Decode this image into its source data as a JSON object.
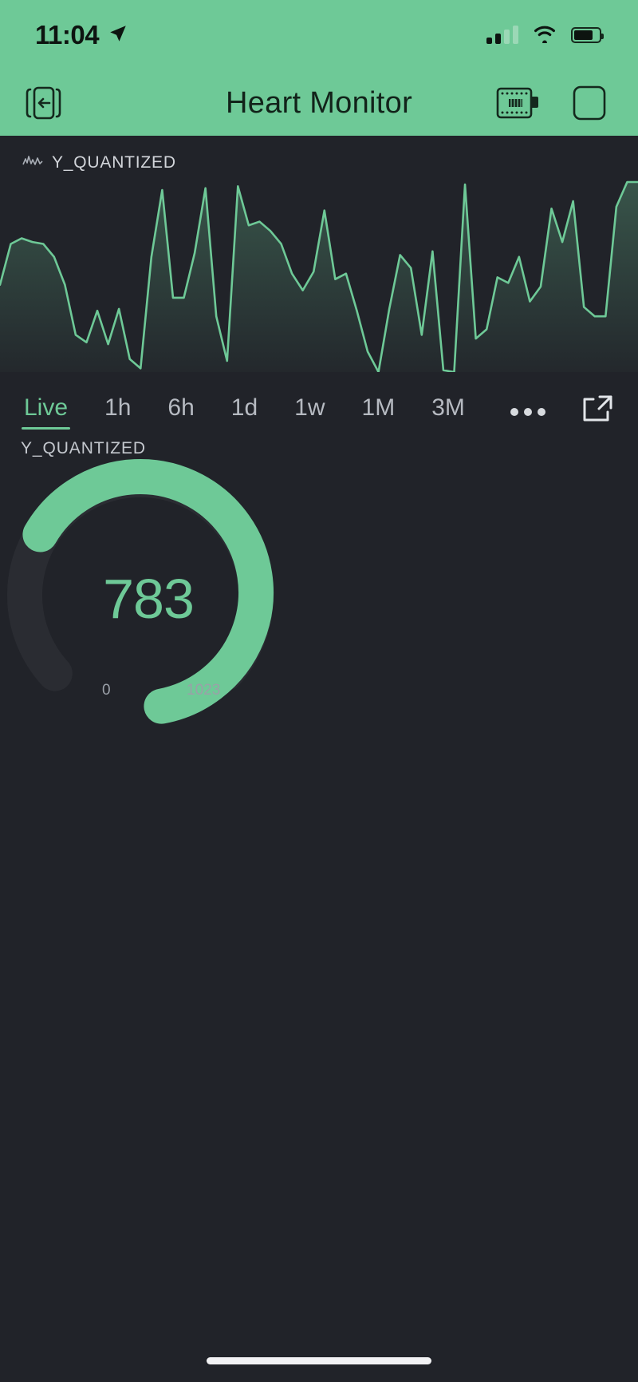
{
  "status_bar": {
    "time": "11:04",
    "location_icon": "location-arrow-icon",
    "signal_icon": "cellular-signal-icon",
    "wifi_icon": "wifi-icon",
    "battery_icon": "battery-icon",
    "signal_bars_filled": 2,
    "signal_bars_total": 4,
    "battery_level_percent": 75
  },
  "nav": {
    "title": "Heart Monitor",
    "back_icon": "device-exit-icon",
    "board_icon": "circuit-board-icon",
    "menu_icon": "rounded-square-icon"
  },
  "sparkline_card": {
    "label": "Y_QUANTIZED",
    "icon": "sparkline-icon"
  },
  "ranges": {
    "items": [
      {
        "label": "Live",
        "active": true
      },
      {
        "label": "1h",
        "active": false
      },
      {
        "label": "6h",
        "active": false
      },
      {
        "label": "1d",
        "active": false
      },
      {
        "label": "1w",
        "active": false
      },
      {
        "label": "1M",
        "active": false
      },
      {
        "label": "3M",
        "active": false
      }
    ],
    "more_icon": "more-options-icon",
    "share_icon": "external-link-icon"
  },
  "gauge": {
    "label": "Y_QUANTIZED",
    "value": "783",
    "min": "0",
    "max": "1023"
  },
  "colors": {
    "accent": "#6ec997",
    "header_bg": "#6ec997",
    "page_bg": "#212329",
    "gauge_track": "#2a2c32",
    "text_primary": "#d2d5da",
    "text_muted": "#9ba0a8"
  },
  "chart_data": {
    "type": "line",
    "title": "Y_QUANTIZED",
    "xlabel": "",
    "ylabel": "Y_QUANTIZED",
    "ylim": [
      0,
      1023
    ],
    "grid": false,
    "legend": "none",
    "series": [
      {
        "name": "Y_QUANTIZED",
        "values": [
          470,
          690,
          720,
          700,
          690,
          620,
          470,
          200,
          160,
          330,
          150,
          340,
          70,
          20,
          620,
          980,
          400,
          400,
          640,
          990,
          300,
          60,
          1000,
          790,
          810,
          760,
          690,
          530,
          440,
          540,
          870,
          500,
          530,
          330,
          110,
          0,
          340,
          630,
          560,
          200,
          650,
          10,
          0,
          1010,
          180,
          230,
          510,
          480,
          620,
          380,
          460,
          880,
          700,
          920,
          350,
          300,
          300,
          890,
          1023,
          1023
        ]
      }
    ],
    "gauge": {
      "type": "radial-gauge",
      "label": "Y_QUANTIZED",
      "value": 783,
      "min": 0,
      "max": 1023,
      "sweep_degrees": 300,
      "fraction_filled": 0.765
    }
  }
}
